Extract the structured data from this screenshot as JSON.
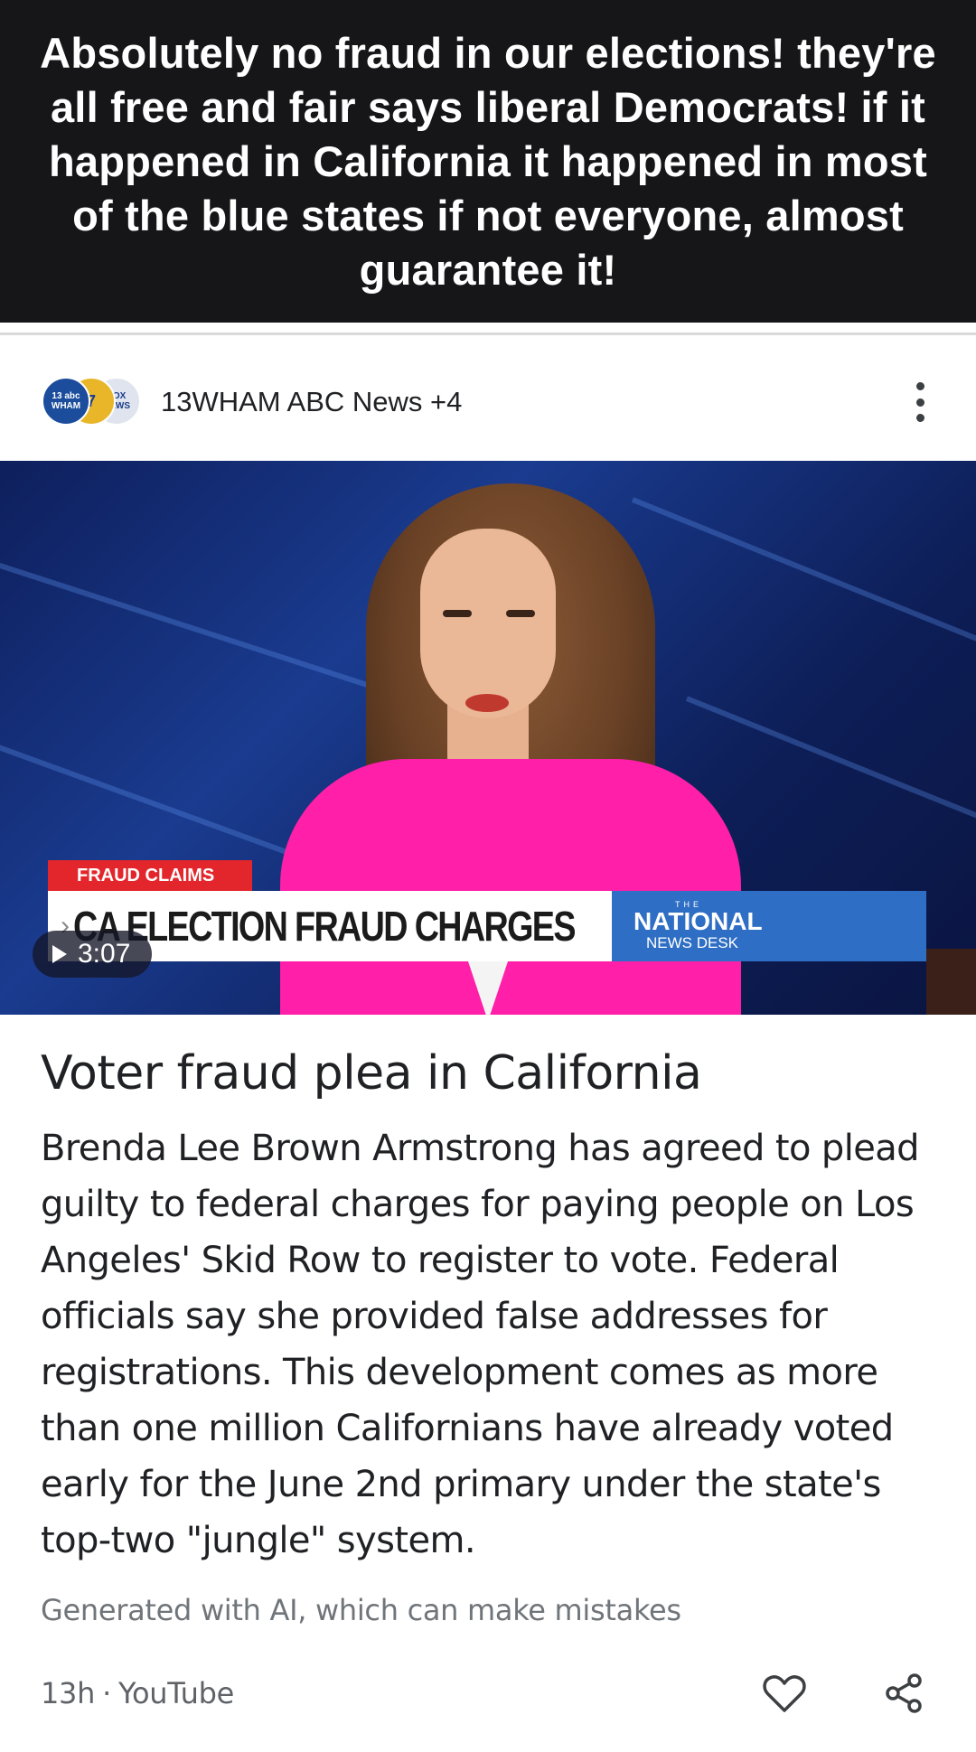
{
  "caption": {
    "text": "Absolutely no fraud in our elections! they're all free and fair says liberal Democrats! if it happened in California it happened in most of the blue states if not everyone, almost guarantee it!"
  },
  "card": {
    "source": {
      "name": "13WHAM ABC News +4",
      "logos": [
        "13 abc WHAM",
        "7",
        "FOX NEWS"
      ]
    },
    "more_icon": "more-vert-icon",
    "video": {
      "lower_third_tag": "FRAUD CLAIMS",
      "lower_third_headline": "CA ELECTION FRAUD CHARGES",
      "brand_the": "THE",
      "brand_main": "NATIONAL",
      "brand_sub": "NEWS DESK",
      "duration": "3:07",
      "colors": {
        "tag_red": "#e3262b",
        "brand_blue": "#2e6ec4",
        "jacket_pink": "#ff1fa8"
      }
    },
    "title": "Voter fraud plea in California",
    "summary": "Brenda Lee Brown Armstrong has agreed to plead guilty to federal charges for paying people on Los Angeles' Skid Row to register to vote. Federal officials say she provided false addresses for registrations. This development comes as more than one million Californians have already voted early for the June 2nd primary under the state's top-two \"jungle\" system.",
    "ai_disclaimer": "Generated with AI, which can make mistakes",
    "meta": {
      "age": "13h",
      "separator": "·",
      "platform": "YouTube"
    },
    "actions": {
      "like_icon": "heart-icon",
      "share_icon": "share-icon"
    }
  }
}
